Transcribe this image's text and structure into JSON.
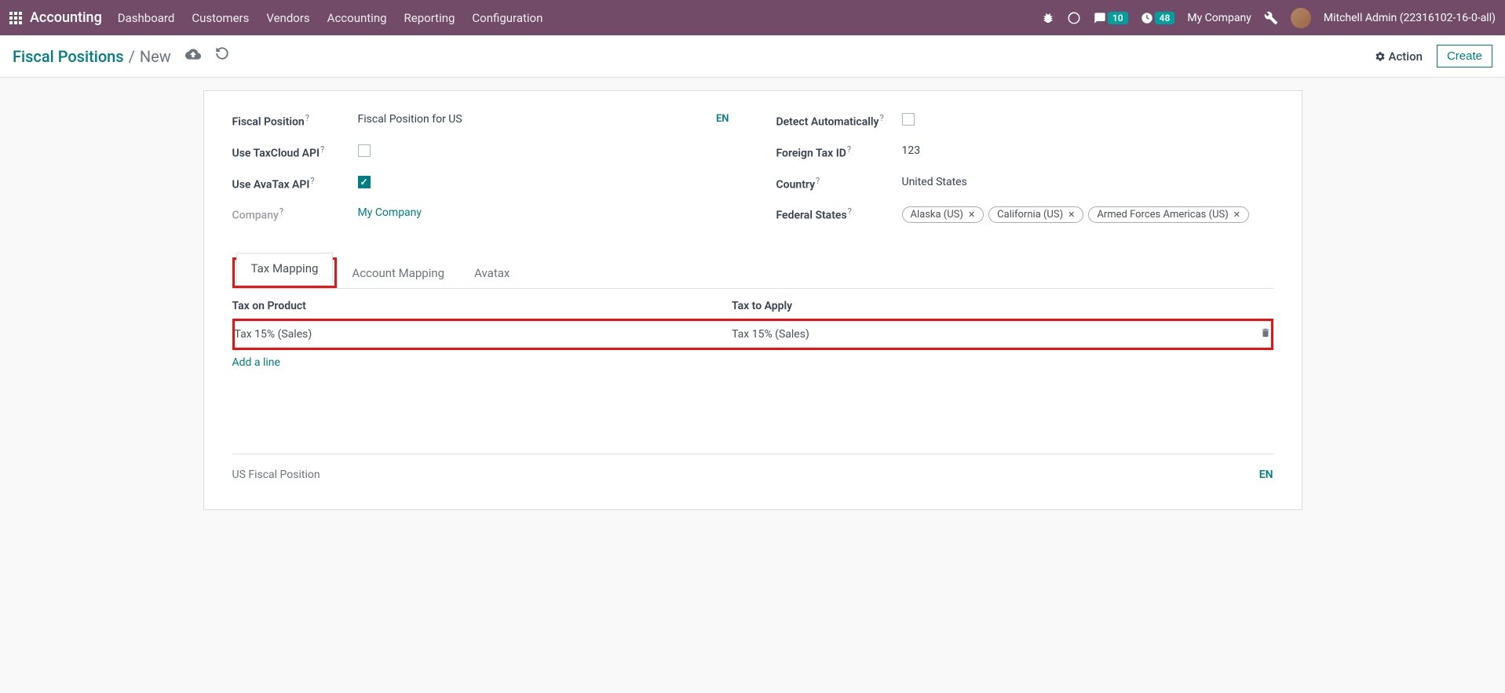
{
  "nav": {
    "brand": "Accounting",
    "items": [
      "Dashboard",
      "Customers",
      "Vendors",
      "Accounting",
      "Reporting",
      "Configuration"
    ],
    "chat_badge": "10",
    "clock_badge": "48",
    "company": "My Company",
    "user": "Mitchell Admin (22316102-16-0-all)"
  },
  "breadcrumb": {
    "root": "Fiscal Positions",
    "current": "New",
    "action_label": "Action",
    "create_label": "Create"
  },
  "form": {
    "left": {
      "fiscal_position_label": "Fiscal Position",
      "fiscal_position_value": "Fiscal Position for US",
      "lang": "EN",
      "taxcloud_label": "Use TaxCloud API",
      "taxcloud_checked": false,
      "avatax_label": "Use AvaTax API",
      "avatax_checked": true,
      "company_label": "Company",
      "company_value": "My Company"
    },
    "right": {
      "detect_label": "Detect Automatically",
      "detect_checked": false,
      "foreign_tax_label": "Foreign Tax ID",
      "foreign_tax_value": "123",
      "country_label": "Country",
      "country_value": "United States",
      "states_label": "Federal States",
      "states": [
        "Alaska (US)",
        "California (US)",
        "Armed Forces Americas (US)"
      ]
    }
  },
  "tabs": [
    "Tax Mapping",
    "Account Mapping",
    "Avatax"
  ],
  "table": {
    "col1": "Tax on Product",
    "col2": "Tax to Apply",
    "row1_col1": "Tax 15% (Sales)",
    "row1_col2": "Tax 15% (Sales)",
    "add_line": "Add a line"
  },
  "footer": {
    "note": "US Fiscal Position",
    "lang": "EN"
  }
}
